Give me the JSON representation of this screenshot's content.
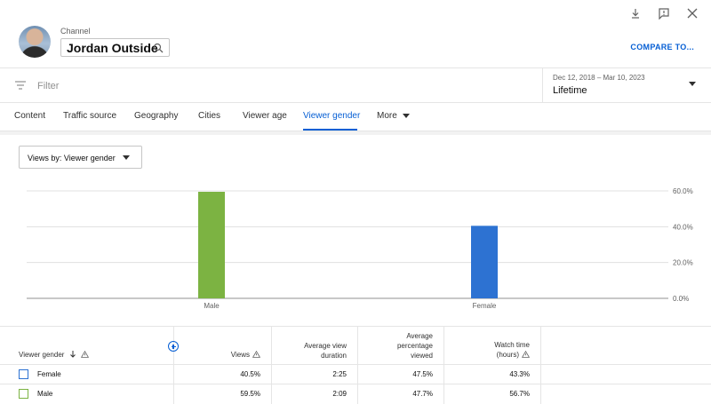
{
  "header": {
    "channel_label": "Channel",
    "channel_name": "Jordan Outside",
    "compare_label": "COMPARE TO..."
  },
  "filter": {
    "placeholder": "Filter",
    "date_range": "Dec 12, 2018 – Mar 10, 2023",
    "date_label": "Lifetime"
  },
  "tabs": [
    {
      "label": "Content",
      "active": false
    },
    {
      "label": "Traffic source",
      "active": false
    },
    {
      "label": "Geography",
      "active": false
    },
    {
      "label": "Cities",
      "active": false
    },
    {
      "label": "Viewer age",
      "active": false
    },
    {
      "label": "Viewer gender",
      "active": true
    },
    {
      "label": "More",
      "active": false
    }
  ],
  "views_dropdown": "Views by: Viewer gender",
  "chart_data": {
    "type": "bar",
    "categories": [
      "Male",
      "Female"
    ],
    "values": [
      59.5,
      40.5
    ],
    "colors": [
      "#7cb342",
      "#2d72d2"
    ],
    "y_ticks": [
      "60.0%",
      "40.0%",
      "20.0%",
      "0.0%"
    ],
    "ylim": [
      0,
      60
    ],
    "grid": true
  },
  "table": {
    "headers": {
      "dimension": "Viewer gender",
      "views": "Views",
      "avg_duration": [
        "Average view",
        "duration"
      ],
      "avg_pct": [
        "Average",
        "percentage",
        "viewed"
      ],
      "watch_time": [
        "Watch time",
        "(hours)"
      ]
    },
    "rows": [
      {
        "label": "Female",
        "color": "#2d72d2",
        "views": "40.5%",
        "avg_duration": "2:25",
        "avg_pct": "47.5%",
        "watch_time": "43.3%"
      },
      {
        "label": "Male",
        "color": "#7cb342",
        "views": "59.5%",
        "avg_duration": "2:09",
        "avg_pct": "47.7%",
        "watch_time": "56.7%"
      }
    ]
  },
  "icons": {
    "download": "download-icon",
    "feedback": "feedback-icon",
    "close": "close-icon",
    "search": "search-icon",
    "filter": "filter-icon"
  }
}
